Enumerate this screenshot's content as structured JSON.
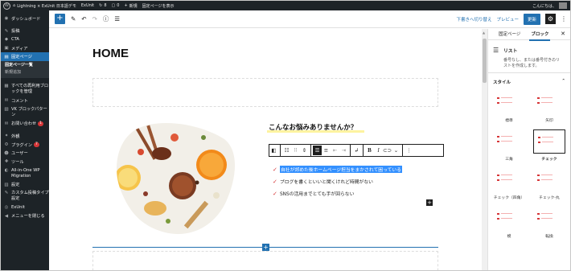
{
  "admin_bar": {
    "items": [
      {
        "icon": "wp-logo",
        "label": ""
      },
      {
        "icon": "home-icon",
        "label": "Lightning × ExUnit 日本語デモ"
      },
      {
        "icon": "",
        "label": "ExUnit"
      },
      {
        "icon": "refresh-icon",
        "label": "8"
      },
      {
        "icon": "comment-icon",
        "label": "0"
      },
      {
        "icon": "plus-icon",
        "label": "新規"
      },
      {
        "icon": "",
        "label": "固定ページを表示"
      }
    ],
    "greeting": "こんにちは、"
  },
  "sidebar": {
    "items": [
      {
        "name": "dashboard",
        "icon": "◉",
        "label": "ダッシュボード"
      },
      {
        "name": "posts",
        "icon": "✎",
        "label": "投稿"
      },
      {
        "name": "cta",
        "icon": "◆",
        "label": "CTA"
      },
      {
        "name": "media",
        "icon": "▣",
        "label": "メディア"
      },
      {
        "name": "pages",
        "icon": "▤",
        "label": "固定ページ",
        "active": true
      },
      {
        "name": "reusable-blocks",
        "icon": "▦",
        "label": "すべての再利用ブロックを管理"
      },
      {
        "name": "comments",
        "icon": "✉",
        "label": "コメント"
      },
      {
        "name": "vk-block-patterns",
        "icon": "▧",
        "label": "VK ブロックパターン"
      },
      {
        "name": "contact",
        "icon": "✉",
        "label": "お問い合わせ",
        "badge": "1"
      },
      {
        "name": "appearance",
        "icon": "✦",
        "label": "外観"
      },
      {
        "name": "plugins",
        "icon": "⚙",
        "label": "プラグイン",
        "badge": "7"
      },
      {
        "name": "users",
        "icon": "☻",
        "label": "ユーザー"
      },
      {
        "name": "tools",
        "icon": "✚",
        "label": "ツール"
      },
      {
        "name": "all-in-one-migration",
        "icon": "◐",
        "label": "All-in-One WP Migration"
      },
      {
        "name": "settings",
        "icon": "▥",
        "label": "設定"
      },
      {
        "name": "custom-post-types",
        "icon": "✎",
        "label": "カスタム投稿タイプ設定"
      },
      {
        "name": "exunit",
        "icon": "◎",
        "label": "ExUnit"
      },
      {
        "name": "collapse-menu",
        "icon": "◀",
        "label": "メニューを閉じる"
      }
    ],
    "submenu": [
      {
        "label": "固定ページ一覧",
        "current": true
      },
      {
        "label": "新規追加",
        "current": false
      }
    ]
  },
  "toolbar": {
    "save_draft": "下書きへ切り替え",
    "preview": "プレビュー",
    "update": "更新"
  },
  "content": {
    "page_title": "HOME",
    "heading": "こんなお悩みありませんか？",
    "list_items": [
      "自社が郊めた後ホームページ担当をまかされて困っている",
      "ブログを書くといいと聞くけれど時間がない",
      "SNSの活用までとても手が回らない"
    ]
  },
  "panel": {
    "tabs": [
      "固定ページ",
      "ブロック"
    ],
    "block_title": "リスト",
    "block_description": "番号なし、または番号付きのリストを作成します。",
    "styles_label": "スタイル",
    "styles": [
      {
        "label": "標準",
        "selected": false
      },
      {
        "label": "矢印",
        "selected": false
      },
      {
        "label": "三角",
        "selected": false
      },
      {
        "label": "チェック",
        "selected": true
      },
      {
        "label": "チェック（四角）",
        "selected": false
      },
      {
        "label": "チェック-丸",
        "selected": false
      },
      {
        "label": "模",
        "selected": false
      },
      {
        "label": "転換",
        "selected": false
      }
    ]
  },
  "colors": {
    "accent": "#2271b1",
    "admin_dark": "#1d2327",
    "check": "#d63638",
    "highlight": "#fdf3a0"
  }
}
